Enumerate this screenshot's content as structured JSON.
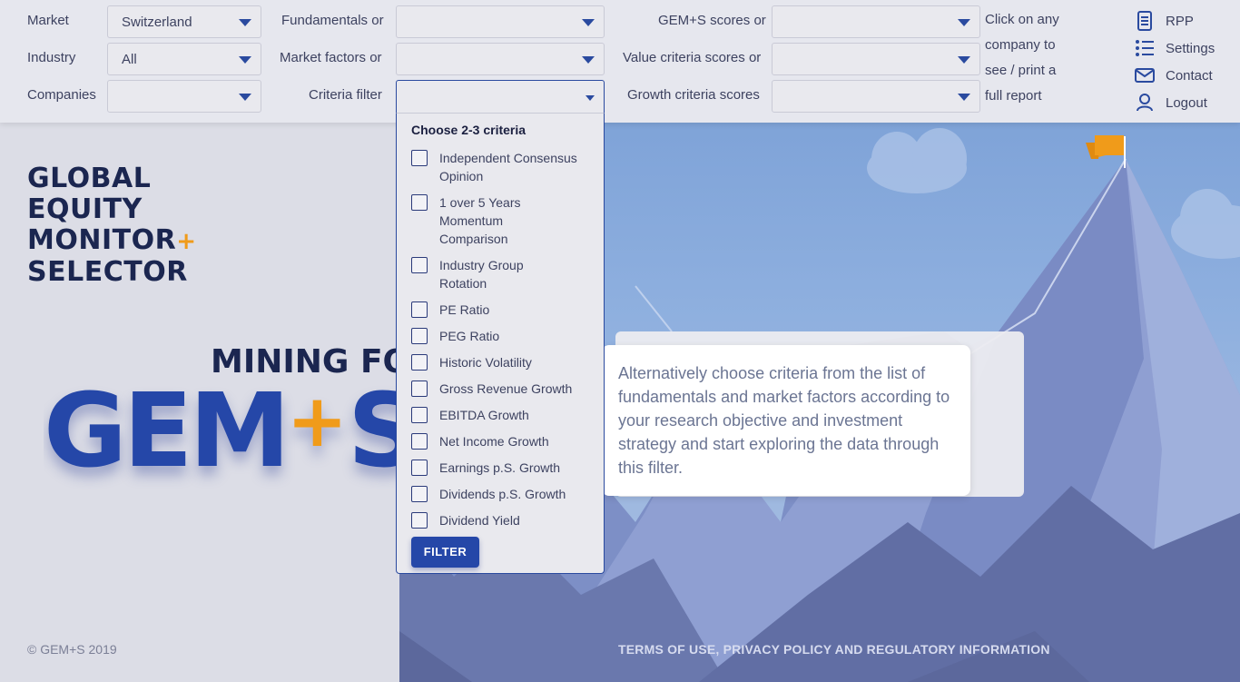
{
  "filters": {
    "market_label": "Market",
    "market_value": "Switzerland",
    "industry_label": "Industry",
    "industry_value": "All",
    "companies_label": "Companies",
    "companies_value": "",
    "fundamentals_label": "Fundamentals or",
    "market_factors_label": "Market factors or",
    "criteria_filter_label": "Criteria filter",
    "gems_scores_label": "GEM+S scores or",
    "value_scores_label": "Value criteria scores or",
    "growth_scores_label": "Growth criteria scores"
  },
  "hint": "Click on any company to see / print a full report",
  "user_menu": [
    {
      "label": "RPP",
      "icon": "document-icon"
    },
    {
      "label": "Settings",
      "icon": "list-icon"
    },
    {
      "label": "Contact",
      "icon": "mail-icon"
    },
    {
      "label": "Logout",
      "icon": "user-icon"
    }
  ],
  "brand": {
    "line1": "GLOBAL",
    "line2": "EQUITY",
    "line3": "MONITOR",
    "line3_plus": "+",
    "line4": "SELECTOR"
  },
  "hero": {
    "mining": "MINING FOR",
    "gems_a": "GEM",
    "gems_plus": "+",
    "gems_b": "S"
  },
  "criteria_dropdown": {
    "title": "Choose 2-3 criteria",
    "options": [
      "Independent Consensus Opinion",
      "1 over 5 Years Momentum Comparison",
      "Industry Group Rotation",
      "PE Ratio",
      "PEG Ratio",
      "Historic Volatility",
      "Gross Revenue Growth",
      "EBITDA Growth",
      "Net Income Growth",
      "Earnings p.S. Growth",
      "Dividends p.S. Growth",
      "Dividend Yield"
    ],
    "button": "FILTER"
  },
  "tooltip": "Alternatively choose criteria from the list of fundamentals and market factors according to your research objective and investment strategy and start exploring the data through this filter.",
  "footer": {
    "copyright": "© GEM+S 2019",
    "terms": "TERMS OF USE, PRIVACY POLICY AND REGULATORY INFORMATION"
  },
  "colors": {
    "accent": "#2547a8",
    "brand_orange": "#f09b1a",
    "navy": "#1b2650"
  }
}
